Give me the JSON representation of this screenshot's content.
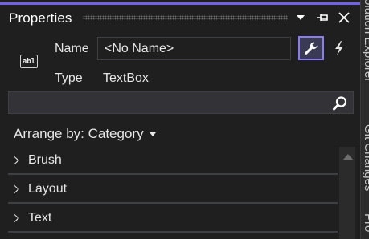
{
  "panel": {
    "title": "Properties"
  },
  "header": {
    "control_icon_text": "abl",
    "name_label": "Name",
    "name_value": "<No Name>",
    "type_label": "Type",
    "type_value": "TextBox"
  },
  "search": {
    "placeholder": ""
  },
  "arrange": {
    "label": "Arrange by: Category"
  },
  "categories": [
    {
      "label": "Brush"
    },
    {
      "label": "Layout"
    },
    {
      "label": "Text"
    }
  ],
  "right_strip": {
    "tabs": [
      "Solution Explorer",
      "Git Changes",
      "Pro"
    ]
  },
  "colors": {
    "accent": "#7160e8",
    "background": "#1f1f1f",
    "selected_button": "#8b7cf6"
  },
  "icons": {
    "dropdown": "chevron-down-icon",
    "pin": "pin-icon",
    "close": "close-icon",
    "properties": "wrench-icon",
    "events": "lightning-icon",
    "search": "search-icon"
  }
}
